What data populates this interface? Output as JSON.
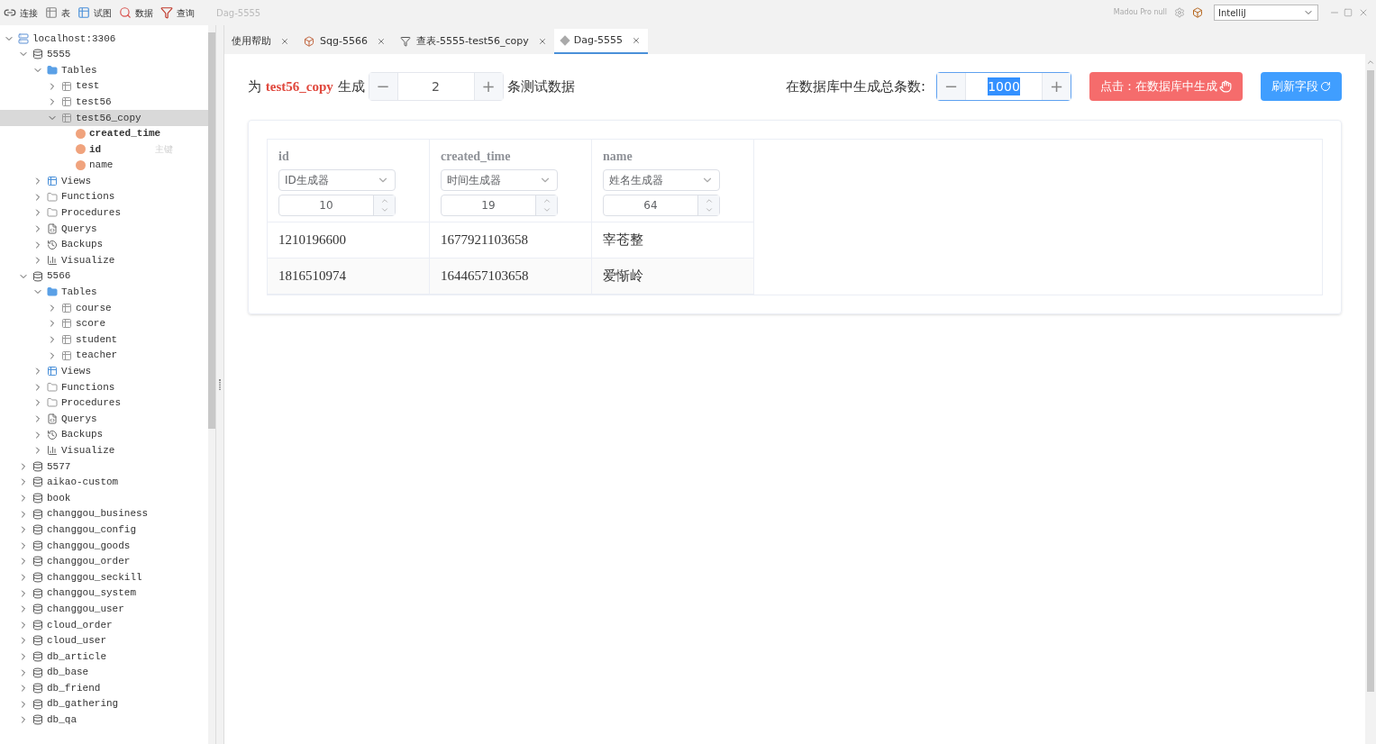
{
  "toolbar": {
    "items": [
      {
        "kind": "connect",
        "label": "连接"
      },
      {
        "kind": "table",
        "label": "表"
      },
      {
        "kind": "view",
        "label": "试图"
      },
      {
        "kind": "data",
        "label": "数据"
      },
      {
        "kind": "query",
        "label": "查询"
      }
    ],
    "title": "Dag-5555",
    "user": "Madou Pro null",
    "theme_select": {
      "value": "IntelliJ"
    }
  },
  "tree": [
    {
      "kind": "server",
      "label": "localhost:3306",
      "expanded": true,
      "children": [
        {
          "kind": "database",
          "label": "5555",
          "expanded": true,
          "children": [
            {
              "kind": "folder",
              "label": "Tables",
              "expanded": true,
              "children": [
                {
                  "kind": "table",
                  "label": "test",
                  "expanded": false,
                  "selected": false
                },
                {
                  "kind": "table",
                  "label": "test56",
                  "expanded": false,
                  "selected": false
                },
                {
                  "kind": "table",
                  "label": "test56_copy",
                  "expanded": true,
                  "selected": true,
                  "children": [
                    {
                      "kind": "field",
                      "label": "created_time",
                      "bold": true
                    },
                    {
                      "kind": "field",
                      "label": "id",
                      "bold": true,
                      "note": "主键"
                    },
                    {
                      "kind": "field",
                      "label": "name",
                      "bold": false
                    }
                  ]
                }
              ]
            },
            {
              "kind": "views",
              "label": "Views",
              "expanded": false
            },
            {
              "kind": "functions",
              "label": "Functions",
              "expanded": false
            },
            {
              "kind": "procedures",
              "label": "Procedures",
              "expanded": false
            },
            {
              "kind": "querys",
              "label": "Querys",
              "expanded": false
            },
            {
              "kind": "backups",
              "label": "Backups",
              "expanded": false
            },
            {
              "kind": "visualize",
              "label": "Visualize",
              "expanded": false
            }
          ]
        },
        {
          "kind": "database",
          "label": "5566",
          "expanded": true,
          "children": [
            {
              "kind": "folder",
              "label": "Tables",
              "expanded": true,
              "children": [
                {
                  "kind": "table",
                  "label": "course",
                  "expanded": false,
                  "selected": false
                },
                {
                  "kind": "table",
                  "label": "score",
                  "expanded": false,
                  "selected": false
                },
                {
                  "kind": "table",
                  "label": "student",
                  "expanded": false,
                  "selected": false
                },
                {
                  "kind": "table",
                  "label": "teacher",
                  "expanded": false,
                  "selected": false
                }
              ]
            },
            {
              "kind": "views",
              "label": "Views",
              "expanded": false
            },
            {
              "kind": "functions",
              "label": "Functions",
              "expanded": false
            },
            {
              "kind": "procedures",
              "label": "Procedures",
              "expanded": false
            },
            {
              "kind": "querys",
              "label": "Querys",
              "expanded": false
            },
            {
              "kind": "backups",
              "label": "Backups",
              "expanded": false
            },
            {
              "kind": "visualize",
              "label": "Visualize",
              "expanded": false
            }
          ]
        },
        {
          "kind": "database",
          "label": "5577",
          "expanded": false
        },
        {
          "kind": "database",
          "label": "aikao-custom",
          "expanded": false
        },
        {
          "kind": "database",
          "label": "book",
          "expanded": false
        },
        {
          "kind": "database",
          "label": "changgou_business",
          "expanded": false
        },
        {
          "kind": "database",
          "label": "changgou_config",
          "expanded": false
        },
        {
          "kind": "database",
          "label": "changgou_goods",
          "expanded": false
        },
        {
          "kind": "database",
          "label": "changgou_order",
          "expanded": false
        },
        {
          "kind": "database",
          "label": "changgou_seckill",
          "expanded": false
        },
        {
          "kind": "database",
          "label": "changgou_system",
          "expanded": false
        },
        {
          "kind": "database",
          "label": "changgou_user",
          "expanded": false
        },
        {
          "kind": "database",
          "label": "cloud_order",
          "expanded": false
        },
        {
          "kind": "database",
          "label": "cloud_user",
          "expanded": false
        },
        {
          "kind": "database",
          "label": "db_article",
          "expanded": false
        },
        {
          "kind": "database",
          "label": "db_base",
          "expanded": false
        },
        {
          "kind": "database",
          "label": "db_friend",
          "expanded": false
        },
        {
          "kind": "database",
          "label": "db_gathering",
          "expanded": false
        },
        {
          "kind": "database",
          "label": "db_qa",
          "expanded": false
        }
      ]
    }
  ],
  "tabs": [
    {
      "kind": "help",
      "label": "使用帮助",
      "selected": false
    },
    {
      "kind": "sql",
      "label": "Sqg-5566",
      "selected": false
    },
    {
      "kind": "query",
      "label": "查表-5555-test56_copy",
      "selected": false
    },
    {
      "kind": "dag",
      "label": "Dag-5555",
      "selected": true
    }
  ],
  "generator": {
    "prefix": "为",
    "table_name": "test56_copy",
    "middle": "生成",
    "count": {
      "value": "2",
      "minus": "−",
      "plus": "+",
      "focused": false
    },
    "suffix": "条测试数据",
    "total_label": "在数据库中生成总条数:",
    "total": {
      "value": "1000",
      "minus": "−",
      "plus": "+",
      "focused": true
    },
    "generate_button": "点击：在数据库中生成",
    "refresh_button": "刷新字段"
  },
  "table": {
    "columns": [
      {
        "name": "id",
        "generator": "ID生成器",
        "length": "10"
      },
      {
        "name": "created_time",
        "generator": "时间生成器",
        "length": "19"
      },
      {
        "name": "name",
        "generator": "姓名生成器",
        "length": "64"
      }
    ],
    "rows": [
      [
        "1210196600",
        "1677921103658",
        "宰苍整"
      ],
      [
        "1816510974",
        "1644657103658",
        "爱惭岭"
      ]
    ]
  }
}
